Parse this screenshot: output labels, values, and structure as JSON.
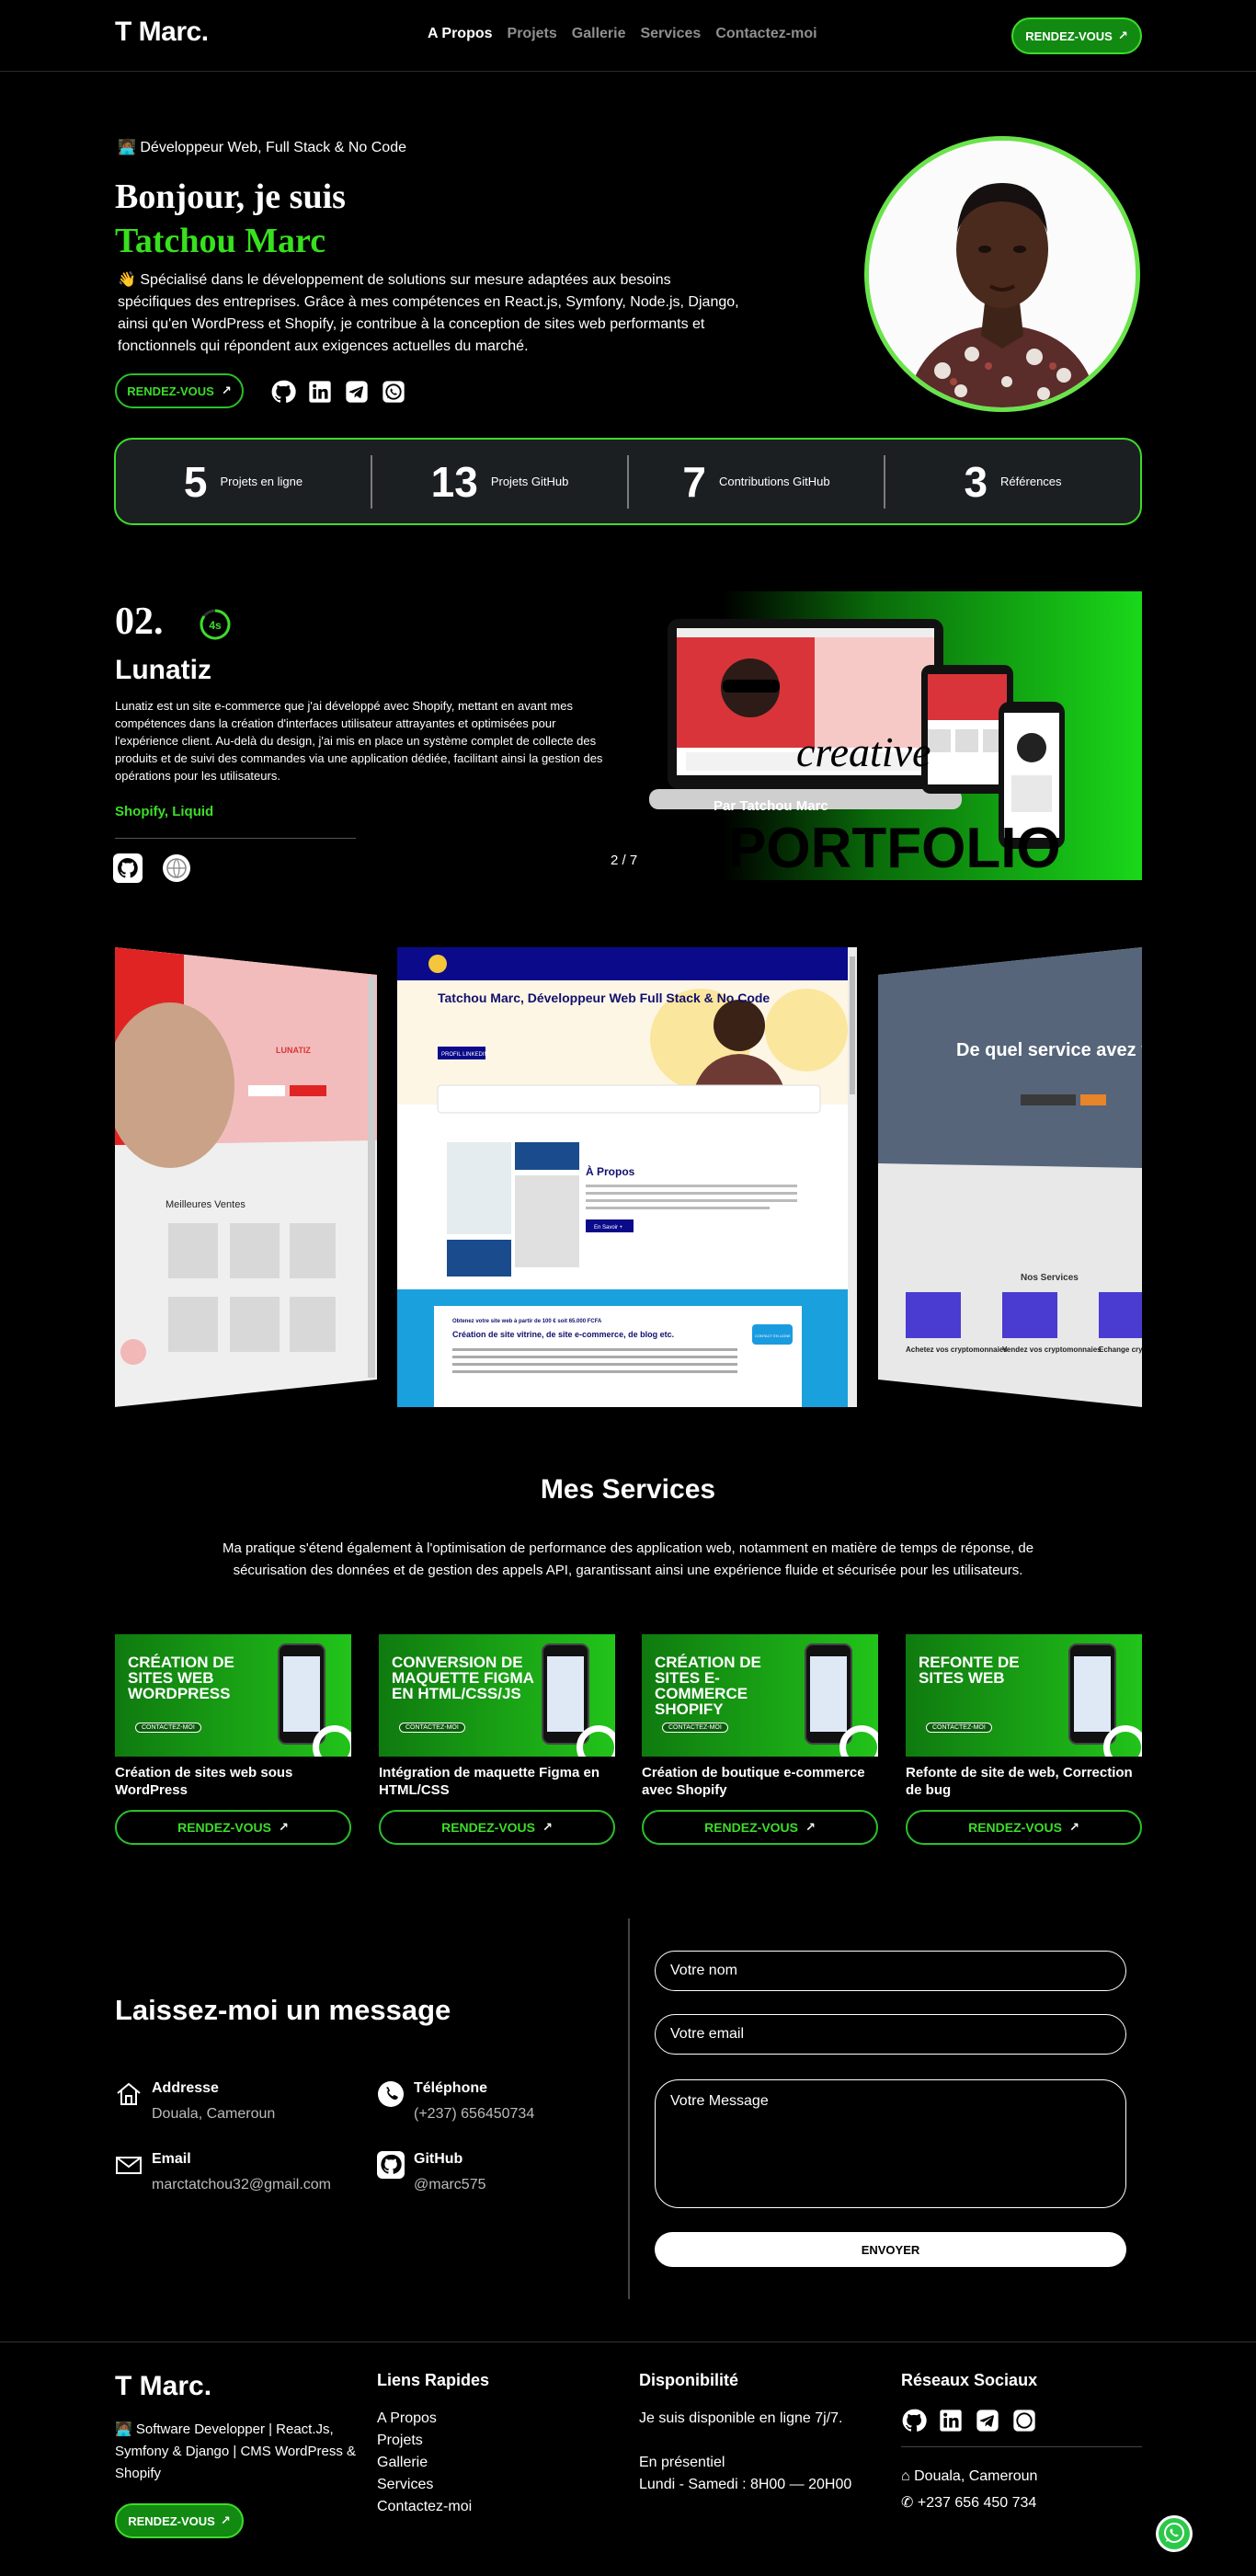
{
  "header": {
    "logo": "T Marc.",
    "nav": [
      "A Propos",
      "Projets",
      "Gallerie",
      "Services",
      "Contactez-moi"
    ],
    "cta": "RENDEZ-VOUS"
  },
  "hero": {
    "role_emoji": "🧑🏾‍💻",
    "role": "Développeur Web, Full Stack & No Code",
    "greeting": "Bonjour, je suis",
    "name": "Tatchou Marc",
    "wave_emoji": "👋",
    "paragraph": "Spécialisé dans le développement de solutions sur mesure adaptées aux besoins spécifiques des entreprises. Grâce à mes compétences en React.js, Symfony, Node.js, Django, ainsi qu'en WordPress et Shopify, je contribue à la conception de sites web performants et fonctionnels qui répondent aux exigences actuelles du marché.",
    "cta": "RENDEZ-VOUS",
    "social_icons": [
      "github-icon",
      "linkedin-icon",
      "telegram-icon",
      "whatsapp-icon"
    ]
  },
  "stats": [
    {
      "num": "5",
      "label": "Projets en ligne"
    },
    {
      "num": "13",
      "label": "Projets GitHub"
    },
    {
      "num": "7",
      "label": "Contributions GitHub"
    },
    {
      "num": "3",
      "label": "Références"
    }
  ],
  "project": {
    "number": "02.",
    "timer": "4s",
    "title": "Lunatiz",
    "description": "Lunatiz est un site e-commerce que j'ai développé avec Shopify, mettant en avant mes compétences dans la création d'interfaces utilisateur attrayantes et optimisées pour l'expérience client. Au-delà du design, j'ai mis en place un système complet de collecte des produits et de suivi des commandes via une application dédiée, facilitant ainsi la gestion des opérations pour les utilisateurs.",
    "tags": "Shopify, Liquid",
    "counter": "2 / 7",
    "banner_script": "creative",
    "banner_by": "Par Tatchou Marc",
    "banner_word": "PORTFOLIO"
  },
  "gallery": {
    "left_brand": "LUNATIZ",
    "left_heading": "Meilleures Ventes",
    "center_hero_title": "Tatchou Marc, Développeur Web Full Stack & No Code",
    "center_hero_btn": "PROFIL LINKEDIN",
    "center_about": "À Propos",
    "center_about_btn": "En Savoir +",
    "center_offer": "Obtenez votre site web à partir de 100 € soit 65.000 FCFA",
    "center_offer_title": "Création de site vitrine, de site e-commerce, de blog etc.",
    "center_offer_badge": "CONTACT EN LIGNE",
    "right_title": "De quel service avez vous besoin ?",
    "right_services": "Nos Services",
    "right_caption1": "Achetez vos cryptomonnaies",
    "right_caption2": "Vendez vos cryptomonnaies",
    "right_caption3": "Echange cryptomon"
  },
  "services": {
    "title": "Mes Services",
    "paragraph": "Ma pratique s'étend également à l'optimisation de performance des application web, notamment en matière de temps de réponse, de sécurisation des données et de gestion des appels API, garantissant ainsi une expérience fluide et sécurisée pour les utilisateurs.",
    "cards": [
      {
        "thumb": "CRÉATION DE SITES WEB WORDPRESS",
        "pill": "CONTACTEZ-MOI",
        "title": "Création de sites web sous WordPress",
        "cta": "RENDEZ-VOUS"
      },
      {
        "thumb": "CONVERSION DE MAQUETTE FIGMA EN HTML/CSS/JS",
        "pill": "CONTACTEZ-MOI",
        "title": "Intégration de maquette Figma en HTML/CSS",
        "cta": "RENDEZ-VOUS"
      },
      {
        "thumb": "CRÉATION DE SITES E-COMMERCE SHOPIFY",
        "pill": "CONTACTEZ-MOI",
        "title": "Création de boutique e-commerce avec Shopify",
        "cta": "RENDEZ-VOUS"
      },
      {
        "thumb": "REFONTE DE SITES WEB",
        "pill": "CONTACTEZ-MOI",
        "title": "Refonte de site de web, Correction de bug",
        "cta": "RENDEZ-VOUS"
      }
    ]
  },
  "contact": {
    "title": "Laissez-moi un message",
    "items": [
      {
        "icon": "home-icon",
        "title": "Addresse",
        "value": "Douala, Cameroun"
      },
      {
        "icon": "phone-icon",
        "title": "Téléphone",
        "value": "(+237) 656450734"
      },
      {
        "icon": "mail-icon",
        "title": "Email",
        "value": "marctatchou32@gmail.com"
      },
      {
        "icon": "github-icon",
        "title": "GitHub",
        "value": "@marc575"
      }
    ],
    "name_placeholder": "Votre nom",
    "email_placeholder": "Votre email",
    "message_placeholder": "Votre Message",
    "send": "ENVOYER"
  },
  "footer": {
    "logo": "T Marc.",
    "emoji": "🧑🏾‍💻",
    "desc": "Software Developper | React.Js, Symfony & Django | CMS WordPress & Shopify",
    "cta": "RENDEZ-VOUS",
    "links_title": "Liens Rapides",
    "links": [
      "A Propos",
      "Projets",
      "Gallerie",
      "Services",
      "Contactez-moi"
    ],
    "avail_title": "Disponibilité",
    "avail_line1": "Je suis disponible en ligne 7j/7.",
    "avail_line2": "En présentiel",
    "avail_line3": "Lundi - Samedi : 8H00 — 20H00",
    "social_title": "Réseaux Sociaux",
    "location": "Douala, Cameroun",
    "phone": "+237 656 450 734"
  },
  "colors": {
    "accent": "#3ddc2a",
    "dark_green": "#128a12",
    "stats_bg": "#1c1f22"
  }
}
